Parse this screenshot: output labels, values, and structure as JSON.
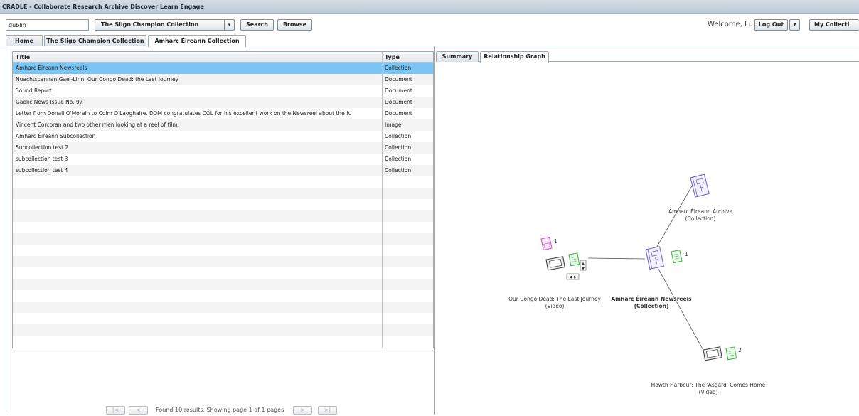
{
  "app": {
    "title": "CRADLE - Collaborate Research Archive Discover Learn Engage"
  },
  "toolbar": {
    "search_value": "dublin",
    "collection_selected": "The Sligo Champion Collection",
    "search_label": "Search",
    "browse_label": "Browse",
    "welcome": "Welcome, Lu",
    "logout_label": "Log Out",
    "dropdown_glyph": "▾",
    "my_collections_label": "My Collecti"
  },
  "tabs": [
    {
      "label": "Home"
    },
    {
      "label": "The Sligo Champion Collection"
    },
    {
      "label": "Amharc Éireann Collection"
    }
  ],
  "grid": {
    "headers": {
      "title": "Title",
      "type": "Type"
    },
    "rows": [
      {
        "title": "Amharc Éireann Newsreels",
        "type": "Collection"
      },
      {
        "title": "Nuachtscannan Gael-Linn.  Our Congo Dead: the Last Journey",
        "type": "Document"
      },
      {
        "title": "Sound Report",
        "type": "Document"
      },
      {
        "title": "Gaelic News Issue No. 97",
        "type": "Document"
      },
      {
        "title": "Letter from Donall O'Morain to Colm O'Laoghaire.  DOM congratulates COL for his excellent work on the Newsreel about the fu",
        "type": "Document"
      },
      {
        "title": "Vincent Corcoran and two other men looking at a reel of film.",
        "type": "Image"
      },
      {
        "title": "Amharc Éireann Subcollection",
        "type": "Collection"
      },
      {
        "title": "Subcollection test 2",
        "type": "Collection"
      },
      {
        "title": "subcollection test 3",
        "type": "Collection"
      },
      {
        "title": "subcollection test 4",
        "type": "Collection"
      }
    ]
  },
  "pager": {
    "first": "|<",
    "prev": "<",
    "next": ">",
    "last": ">|",
    "text": "Found 10 results. Showing page 1 of 1 pages"
  },
  "right_tabs": [
    {
      "label": "Summary"
    },
    {
      "label": "Relationship Graph"
    }
  ],
  "graph": {
    "archive": {
      "name": "Amharc Éireann Archive",
      "kind": "(Collection)"
    },
    "newsreels": {
      "name": "Amharc Éireann Newsreels",
      "kind": "(Collection)",
      "count": "1"
    },
    "congo": {
      "name": "Our Congo Dead: The Last Journey",
      "kind": "(Video)",
      "count": "1"
    },
    "howth": {
      "name": "Howth Harbour: The 'Asgard' Comes Home",
      "kind": "(Video)",
      "count": "2"
    },
    "colors": {
      "collection": "#6a5acd",
      "document": "#3cb043",
      "image": "#d94fc4",
      "video": "#333333"
    }
  }
}
